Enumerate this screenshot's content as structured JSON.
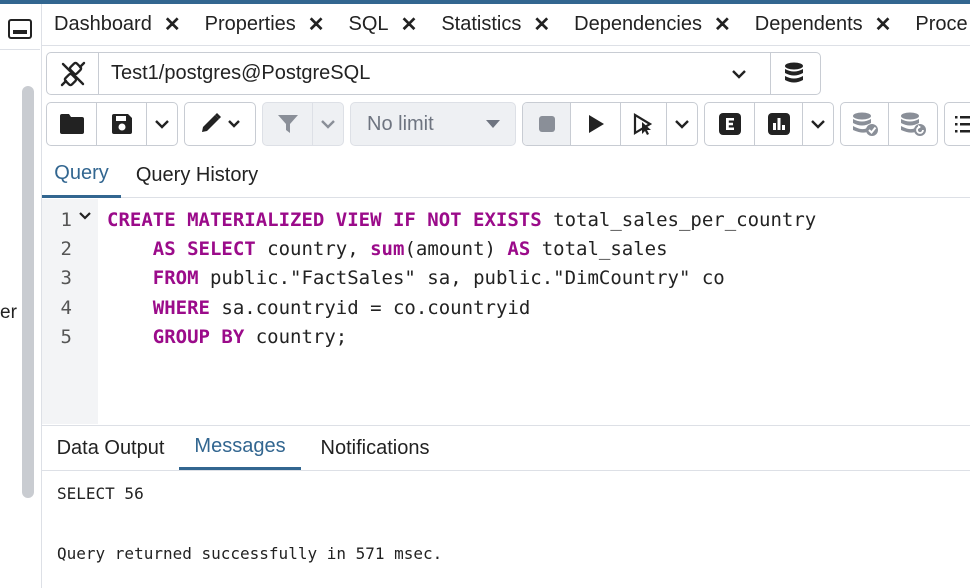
{
  "left_panel": {
    "partial_label": "er"
  },
  "tabs": [
    {
      "label": "Dashboard",
      "close": "✕"
    },
    {
      "label": "Properties",
      "close": "✕"
    },
    {
      "label": "SQL",
      "close": "✕"
    },
    {
      "label": "Statistics",
      "close": "✕"
    },
    {
      "label": "Dependencies",
      "close": "✕"
    },
    {
      "label": "Dependents",
      "close": "✕"
    },
    {
      "label": "Proce"
    }
  ],
  "connection": {
    "label": "Test1/postgres@PostgreSQL"
  },
  "toolbar": {
    "limit_label": "No limit"
  },
  "editor_tabs": {
    "query": "Query",
    "history": "Query History"
  },
  "editor": {
    "lines": [
      {
        "number": "1",
        "tokens": [
          {
            "t": "CREATE MATERIALIZED VIEW IF NOT EXISTS",
            "kw": true
          },
          {
            "t": " total_sales_per_country",
            "kw": false
          }
        ]
      },
      {
        "number": "2",
        "tokens": [
          {
            "t": "    ",
            "kw": false
          },
          {
            "t": "AS SELECT",
            "kw": true
          },
          {
            "t": " country, ",
            "kw": false
          },
          {
            "t": "sum",
            "kw": true
          },
          {
            "t": "(amount) ",
            "kw": false
          },
          {
            "t": "AS",
            "kw": true
          },
          {
            "t": " total_sales",
            "kw": false
          }
        ]
      },
      {
        "number": "3",
        "tokens": [
          {
            "t": "    ",
            "kw": false
          },
          {
            "t": "FROM",
            "kw": true
          },
          {
            "t": " public.\"FactSales\" sa, public.\"DimCountry\" co",
            "kw": false
          }
        ]
      },
      {
        "number": "4",
        "tokens": [
          {
            "t": "    ",
            "kw": false
          },
          {
            "t": "WHERE",
            "kw": true
          },
          {
            "t": " sa.countryid = co.countryid",
            "kw": false
          }
        ]
      },
      {
        "number": "5",
        "tokens": [
          {
            "t": "    ",
            "kw": false
          },
          {
            "t": "GROUP BY",
            "kw": true
          },
          {
            "t": " country;",
            "kw": false
          }
        ]
      }
    ]
  },
  "output_tabs": {
    "data_output": "Data Output",
    "messages": "Messages",
    "notifications": "Notifications"
  },
  "messages": {
    "line1": "SELECT 56",
    "line2": "Query returned successfully in 571 msec."
  },
  "colors": {
    "accent": "#326690",
    "keyword": "#9b0b8a"
  }
}
